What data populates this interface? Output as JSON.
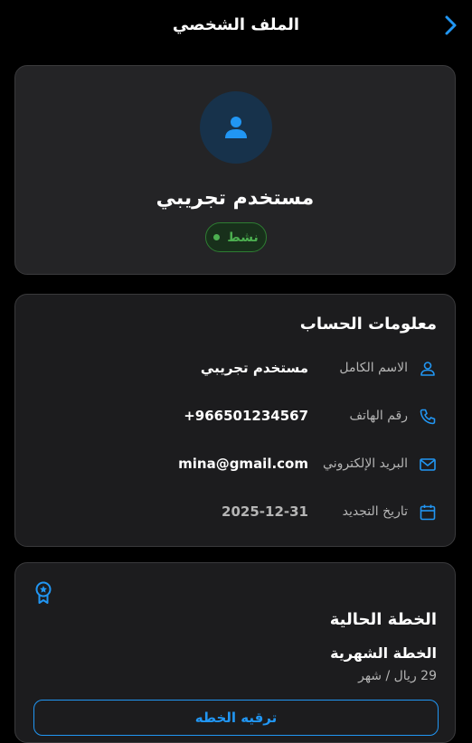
{
  "header": {
    "title": "الملف الشخصي"
  },
  "profile": {
    "name": "مستخدم تجريبي",
    "status": "نشط"
  },
  "account_info": {
    "title": "معلومات الحساب",
    "rows": [
      {
        "icon": "user-icon",
        "label": "الاسم الكامل",
        "value": "مستخدم تجريبي"
      },
      {
        "icon": "phone-icon",
        "label": "رقم الهاتف",
        "value": "+966501234567"
      },
      {
        "icon": "mail-icon",
        "label": "البريد الإلكتروني",
        "value": "mina@gmail.com"
      },
      {
        "icon": "calendar-icon",
        "label": "تاريخ التجديد",
        "value": "2025-12-31"
      }
    ]
  },
  "plan": {
    "title": "الخطة الحالية",
    "name": "الخطة الشهرية",
    "price": "29 ريال / شهر",
    "upgrade_label": "ترقيه الخطه"
  },
  "colors": {
    "accent": "#2196f3",
    "status": "#4caf50",
    "background": "#000000",
    "card": "#1c1c1e"
  }
}
